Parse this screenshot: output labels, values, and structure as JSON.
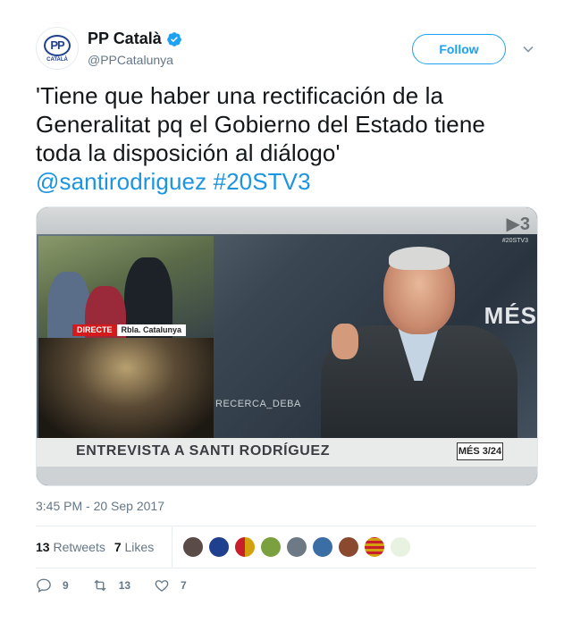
{
  "account": {
    "display_name": "PP Català",
    "handle": "@PPCatalunya",
    "avatar_logo_text": "PP",
    "avatar_logo_subtext": "CATALÀ",
    "verified": true
  },
  "header": {
    "follow_label": "Follow"
  },
  "tweet": {
    "text": "'Tiene que haber una rectificación de la Generalitat pq el Gobierno del Estado tiene toda la disposición al diálogo'",
    "mention": "@santirodriguez",
    "hashtag": "#20STV3",
    "timestamp": "3:45 PM - 20 Sep 2017"
  },
  "media": {
    "lower_third": "ENTREVISTA A SANTI RODRÍGUEZ",
    "badge": "MÉS 3/24",
    "directe_label": "DIRECTE",
    "location_label": "Rbla. Catalunya",
    "background_text": "MÉS",
    "recerca_text": "RECERCA_DEBA",
    "channel_hashtag": "#20STV3"
  },
  "stats": {
    "retweets_count": "13",
    "retweets_label": "Retweets",
    "likes_count": "7",
    "likes_label": "Likes"
  },
  "likers": [
    {
      "color": "#5a4a48"
    },
    {
      "color": "#1f3f8f"
    },
    {
      "color": "#d9a010"
    },
    {
      "color": "#7aa040"
    },
    {
      "color": "#6d7a86"
    },
    {
      "color": "#3a6ea5"
    },
    {
      "color": "#8b4a30"
    },
    {
      "color": "#d4a010"
    },
    {
      "color": "#e8f2e0"
    }
  ],
  "actions": {
    "replies": "9",
    "retweets": "13",
    "likes": "7"
  },
  "colors": {
    "accent": "#1da1f2",
    "link": "#1b95e0",
    "muted": "#657786"
  }
}
